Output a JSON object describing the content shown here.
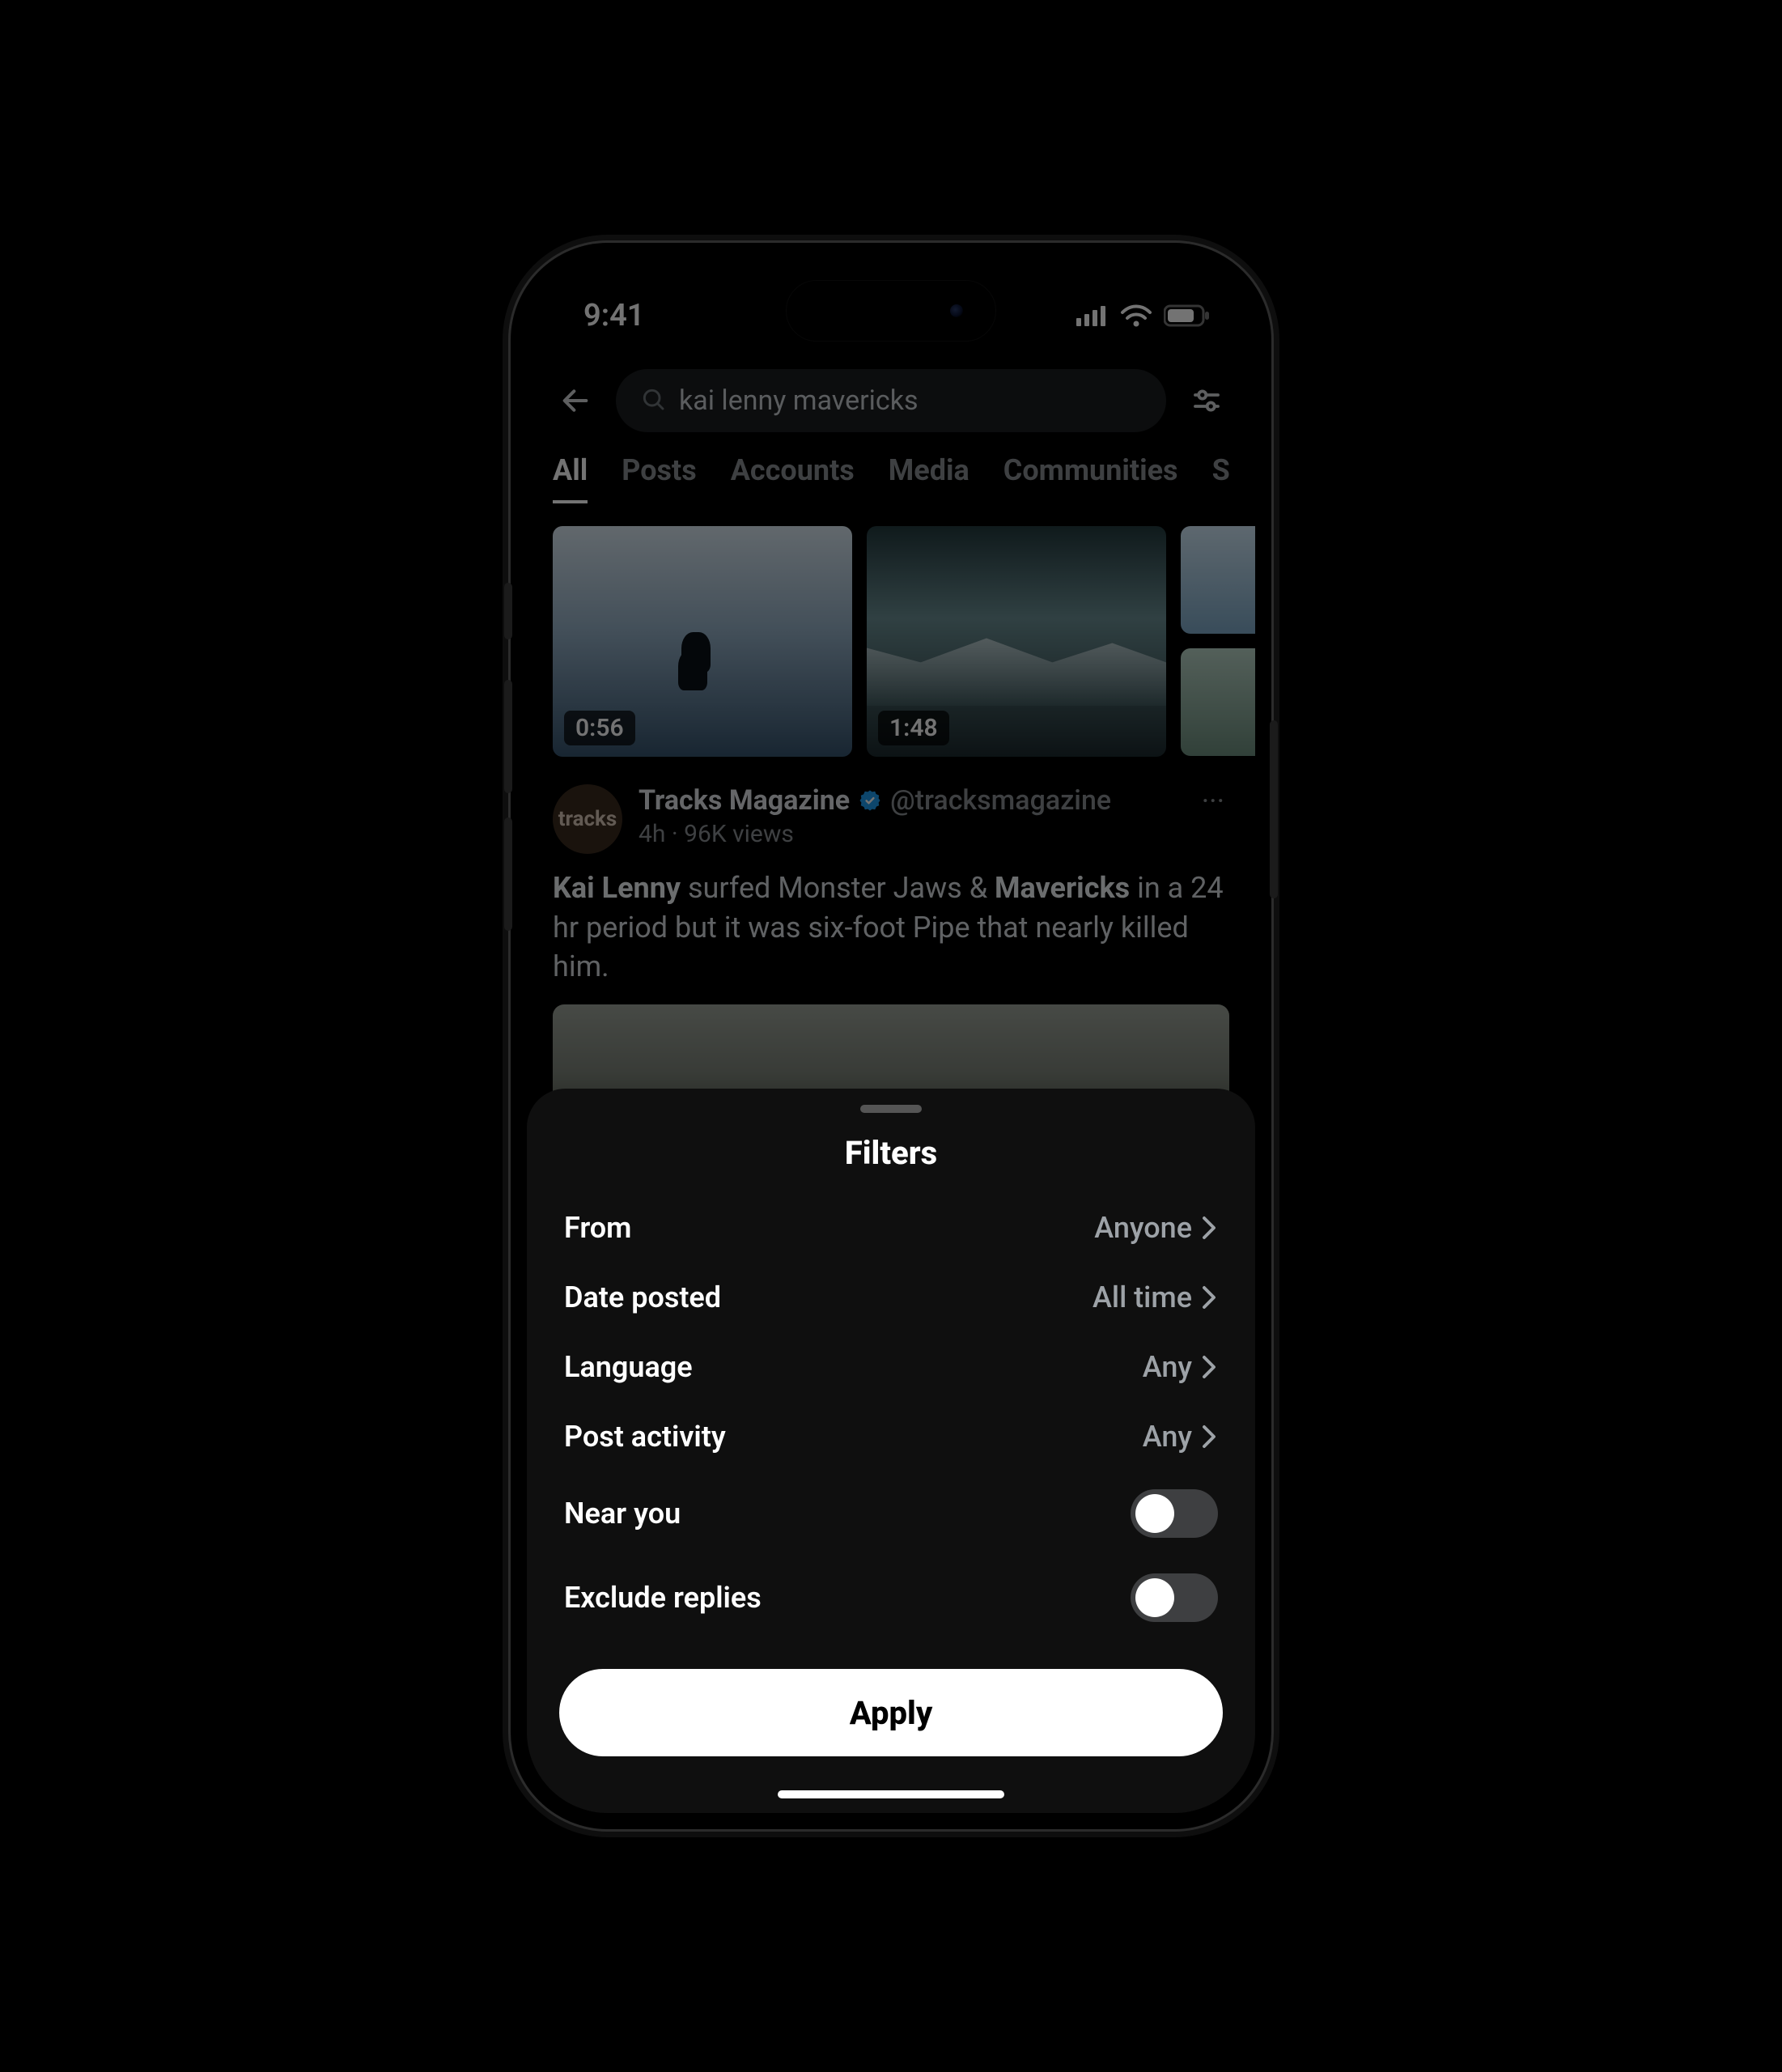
{
  "status": {
    "time": "9:41"
  },
  "search": {
    "query": "kai lenny mavericks"
  },
  "tabs": [
    "All",
    "Posts",
    "Accounts",
    "Media",
    "Communities",
    "S"
  ],
  "active_tab": 0,
  "thumbs": [
    {
      "duration": "0:56"
    },
    {
      "duration": "1:48"
    }
  ],
  "post": {
    "avatar_text": "tracks",
    "display_name": "Tracks Magazine",
    "handle": "@tracksmagazine",
    "sub": "4h · 96K views",
    "body_pre_bold1": "Kai Lenny",
    "body_mid": " surfed Monster Jaws & ",
    "body_bold2": "Mavericks",
    "body_end": " in a 24 hr period but it was six-foot Pipe that nearly killed him."
  },
  "sheet": {
    "title": "Filters",
    "rows": [
      {
        "label": "From",
        "value": "Anyone",
        "type": "nav"
      },
      {
        "label": "Date posted",
        "value": "All time",
        "type": "nav"
      },
      {
        "label": "Language",
        "value": "Any",
        "type": "nav"
      },
      {
        "label": "Post activity",
        "value": "Any",
        "type": "nav"
      },
      {
        "label": "Near you",
        "value": "off",
        "type": "toggle"
      },
      {
        "label": "Exclude replies",
        "value": "off",
        "type": "toggle"
      }
    ],
    "apply": "Apply"
  }
}
